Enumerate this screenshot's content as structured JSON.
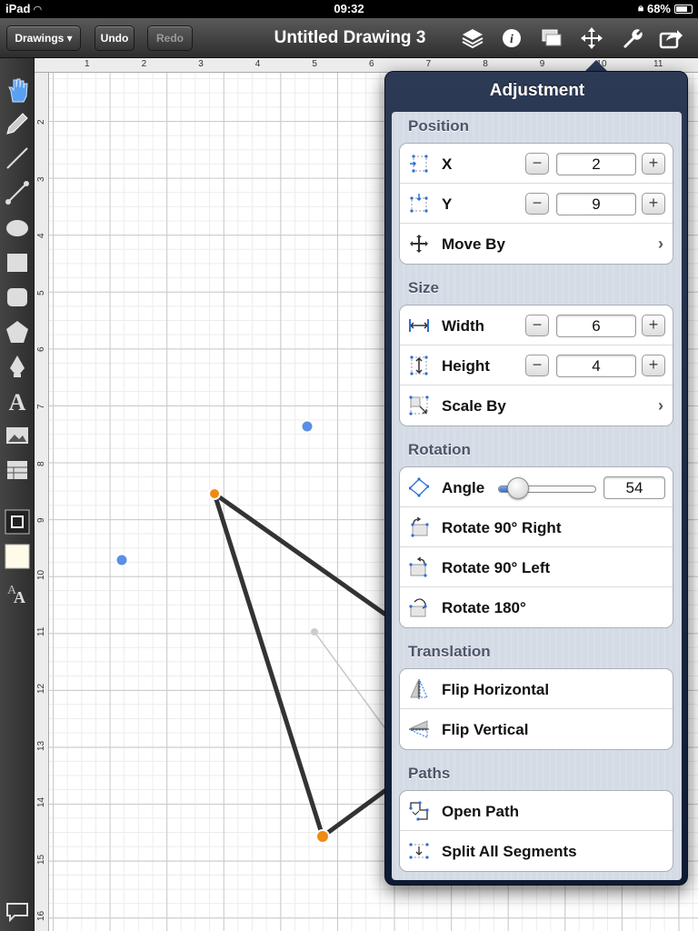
{
  "status_bar": {
    "device": "iPad",
    "time": "09:32",
    "battery": "68%"
  },
  "toolbar": {
    "drawings_label": "Drawings ▾",
    "undo_label": "Undo",
    "redo_label": "Redo",
    "title": "Untitled Drawing 3",
    "icons": [
      "layers-icon",
      "info-icon",
      "canvases-icon",
      "adjust-move-icon",
      "wrench-icon",
      "share-icon"
    ]
  },
  "tools": [
    "selection-hand-icon",
    "pencil-icon",
    "line-icon",
    "connector-line-icon",
    "ellipse-icon",
    "rectangle-icon",
    "rounded-rect-icon",
    "polygon-icon",
    "pen-icon",
    "text-tool-icon",
    "image-icon",
    "table-icon",
    "stroke-color-icon",
    "fill-color-icon",
    "text-style-icon"
  ],
  "ruler": {
    "top": [
      "1",
      "2",
      "3",
      "4",
      "5",
      "6",
      "7",
      "8",
      "9",
      "10",
      "11"
    ],
    "left": [
      "2",
      "3",
      "4",
      "5",
      "6",
      "7",
      "8",
      "9",
      "10",
      "11",
      "12",
      "13",
      "14",
      "15",
      "16"
    ]
  },
  "colors": {
    "accent": "#2f6fd0",
    "handle_orange": "#f08a12",
    "handle_blue": "#5b8ee6",
    "stroke": "#333333"
  },
  "panel": {
    "title": "Adjustment",
    "position": {
      "header": "Position",
      "x_label": "X",
      "x_value": "2",
      "y_label": "Y",
      "y_value": "9",
      "move_by_label": "Move By"
    },
    "size": {
      "header": "Size",
      "width_label": "Width",
      "width_value": "6",
      "height_label": "Height",
      "height_value": "4",
      "scale_by_label": "Scale By"
    },
    "rotation": {
      "header": "Rotation",
      "angle_label": "Angle",
      "angle_value": "54",
      "angle_fraction": 0.2,
      "rotate_right_label": "Rotate 90° Right",
      "rotate_left_label": "Rotate 90° Left",
      "rotate_180_label": "Rotate 180°"
    },
    "translation": {
      "header": "Translation",
      "flip_h_label": "Flip Horizontal",
      "flip_v_label": "Flip Vertical"
    },
    "paths": {
      "header": "Paths",
      "open_path_label": "Open Path",
      "split_label": "Split All Segments"
    },
    "stepper_minus": "−",
    "stepper_plus": "+",
    "chevron": "›"
  }
}
